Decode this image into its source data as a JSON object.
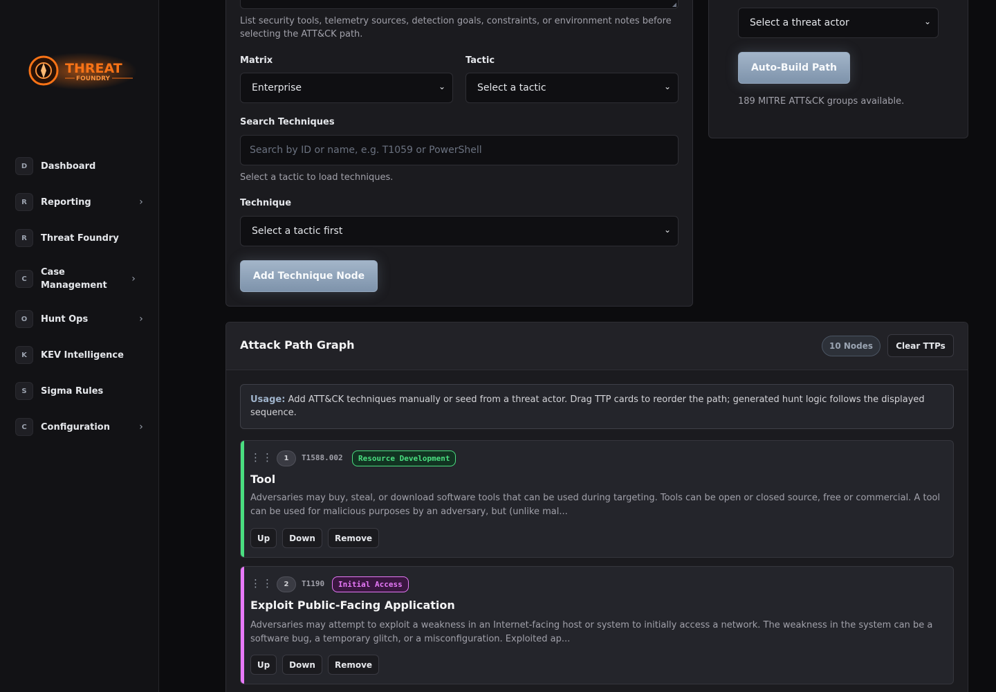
{
  "sidebar": {
    "logo_text": "THREAT FOUNDRY",
    "items": [
      {
        "badge": "D",
        "label": "Dashboard",
        "chevron": false
      },
      {
        "badge": "R",
        "label": "Reporting",
        "chevron": true
      },
      {
        "badge": "R",
        "label": "Threat Foundry",
        "chevron": false
      },
      {
        "badge": "C",
        "label": "Case Management",
        "chevron": true
      },
      {
        "badge": "O",
        "label": "Hunt Ops",
        "chevron": true
      },
      {
        "badge": "K",
        "label": "KEV Intelligence",
        "chevron": false
      },
      {
        "badge": "S",
        "label": "Sigma Rules",
        "chevron": false
      },
      {
        "badge": "C",
        "label": "Configuration",
        "chevron": true
      }
    ]
  },
  "builder": {
    "notes_help": "List security tools, telemetry sources, detection goals, constraints, or environment notes before selecting the ATT&CK path.",
    "matrix_label": "Matrix",
    "matrix_value": "Enterprise",
    "tactic_label": "Tactic",
    "tactic_value": "Select a tactic",
    "search_label": "Search Techniques",
    "search_placeholder": "Search by ID or name, e.g. T1059 or PowerShell",
    "search_help": "Select a tactic to load techniques.",
    "technique_label": "Technique",
    "technique_value": "Select a tactic first",
    "add_button": "Add Technique Node"
  },
  "actor": {
    "select_value": "Select a threat actor",
    "autobuild_button": "Auto-Build Path",
    "groups_text": "189 MITRE ATT&CK groups available."
  },
  "graph": {
    "title": "Attack Path Graph",
    "nodes_badge": "10 Nodes",
    "clear_button": "Clear TTPs",
    "usage_label": "Usage:",
    "usage_text": " Add ATT&CK techniques manually or seed from a threat actor. Drag TTP cards to reorder the path; generated hunt logic follows the displayed sequence.",
    "cards": [
      {
        "index": "1",
        "id": "T1588.002",
        "tactic": "Resource Development",
        "title": "Tool",
        "description": "Adversaries may buy, steal, or download software tools that can be used during targeting. Tools can be open or closed source, free or commercial. A tool can be used for malicious purposes by an adversary, but (unlike mal...",
        "up": "Up",
        "down": "Down",
        "remove": "Remove",
        "accent": "#4ade80"
      },
      {
        "index": "2",
        "id": "T1190",
        "tactic": "Initial Access",
        "title": "Exploit Public-Facing Application",
        "description": "Adversaries may attempt to exploit a weakness in an Internet-facing host or system to initially access a network. The weakness in the system can be a software bug, a temporary glitch, or a misconfiguration. Exploited ap...",
        "up": "Up",
        "down": "Down",
        "remove": "Remove",
        "accent": "#e879f9"
      }
    ]
  }
}
